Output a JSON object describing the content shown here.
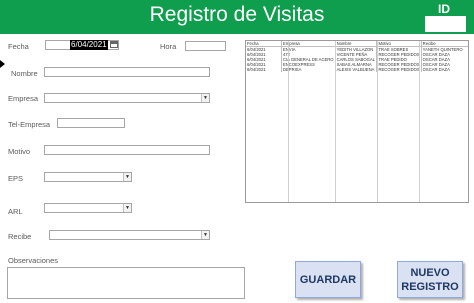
{
  "header": {
    "title": "Registro de Visitas",
    "id_label": "ID",
    "id_value": ""
  },
  "form": {
    "fecha": {
      "label": "Fecha",
      "value": "6/04/2021"
    },
    "hora": {
      "label": "Hora",
      "value": ""
    },
    "nombre": {
      "label": "Nombre",
      "value": ""
    },
    "empresa": {
      "label": "Empresa",
      "value": ""
    },
    "tel_empresa": {
      "label": "Tel-Empresa",
      "value": ""
    },
    "motivo": {
      "label": "Motivo",
      "value": ""
    },
    "eps": {
      "label": "EPS",
      "value": ""
    },
    "arl": {
      "label": "ARL",
      "value": ""
    },
    "recibe": {
      "label": "Recibe",
      "value": ""
    },
    "observaciones": {
      "label": "Observaciones",
      "value": ""
    }
  },
  "table": {
    "headers": [
      "Fecha",
      "Empresa",
      "Nombre",
      "Motivo",
      "Recibe"
    ],
    "rows": [
      [
        "6/04/2021",
        "ENVIA",
        "YEDITH VILLAZON",
        "TRAE SOBRES",
        "YANETH QUINTERO"
      ],
      [
        "6/04/2021",
        "472",
        "VICENTE PEÑA",
        "RECOGER PEDIDOS",
        "OSCAR DAZA"
      ],
      [
        "6/04/2021",
        "CIA GENERAL DE ACERO",
        "CARLOS SABOGAL",
        "TRAE PEDIDO",
        "OSCAR DAZA"
      ],
      [
        "6/04/2021",
        "ENCOEXPRESS",
        "SABAS ALMARNA",
        "RECOGER PEDIDOS",
        "OSCAR DAZA"
      ],
      [
        "6/04/2021",
        "DEPRISA",
        "ALEXIS VALBUENA",
        "RECOGER PEDIDOS",
        "OSCAR DAZA"
      ]
    ]
  },
  "buttons": {
    "guardar": "GUARDAR",
    "nuevo_line1": "NUEVO",
    "nuevo_line2": "REGISTRO"
  },
  "colors": {
    "header": "#0f9d4e",
    "button_bg": "#d9e1f2",
    "button_text": "#1f3864"
  }
}
